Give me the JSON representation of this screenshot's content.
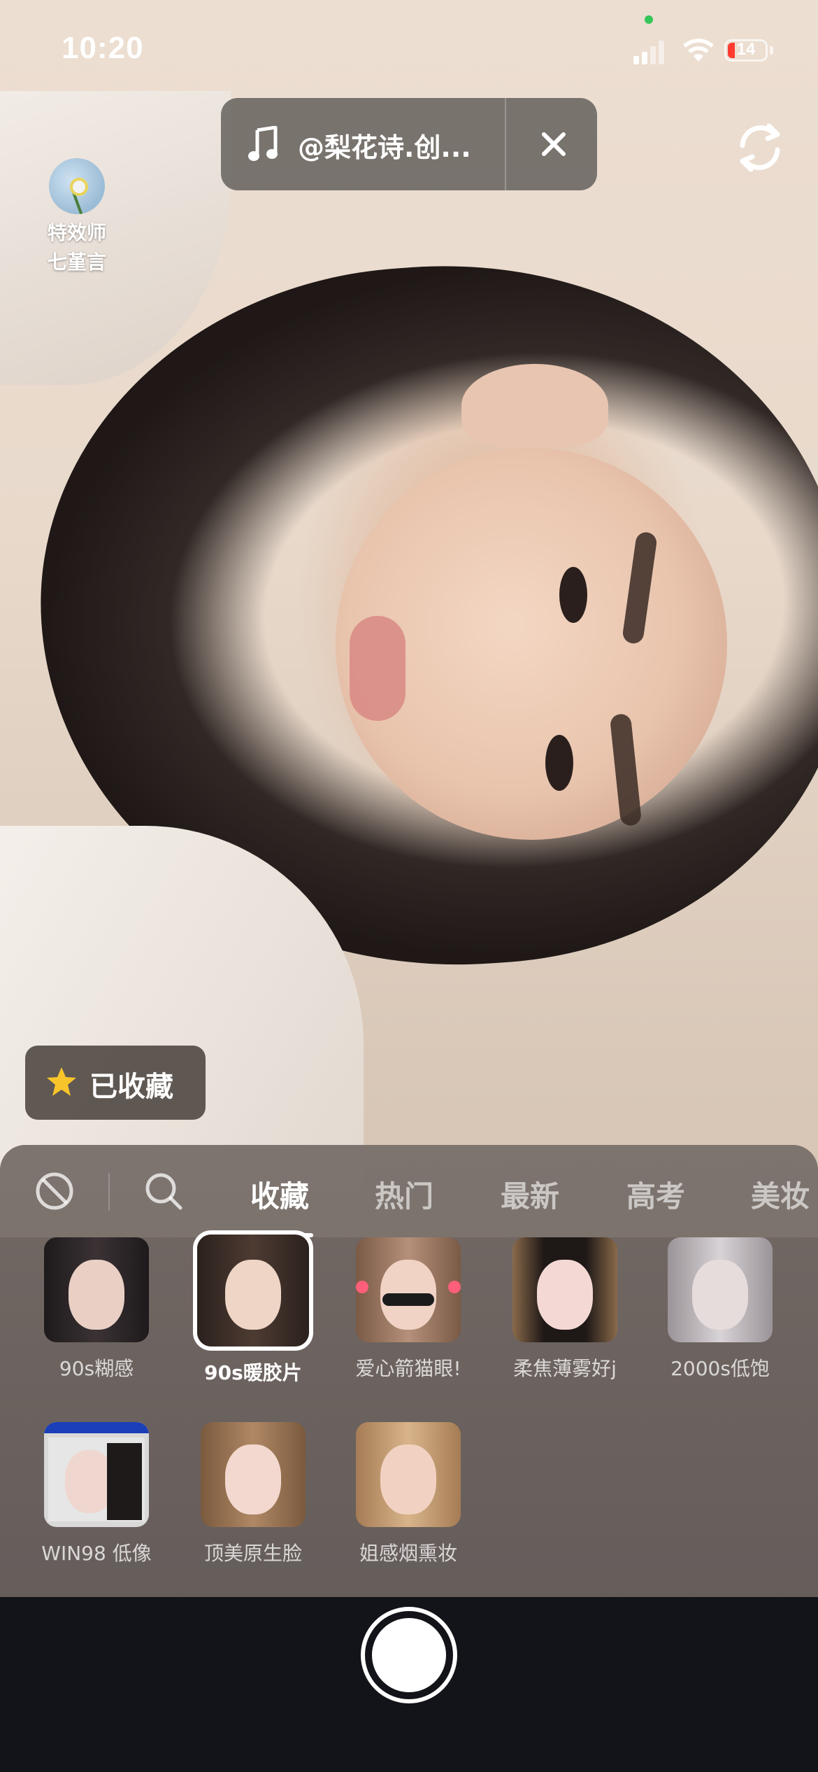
{
  "status_bar": {
    "time": "10:20",
    "battery": "14"
  },
  "music": {
    "label": "@梨花诗.创..."
  },
  "creator": {
    "line1": "特效师",
    "line2": "七堇言"
  },
  "favorite_button": {
    "label": "已收藏"
  },
  "tabs": [
    {
      "label": "收藏",
      "active": true
    },
    {
      "label": "热门",
      "active": false
    },
    {
      "label": "最新",
      "active": false
    },
    {
      "label": "高考",
      "active": false
    },
    {
      "label": "美妆",
      "active": false
    }
  ],
  "effects": [
    {
      "label": "90s糊感",
      "selected": false
    },
    {
      "label": "90s暖胶片",
      "selected": true
    },
    {
      "label": "爱心箭猫眼!",
      "selected": false
    },
    {
      "label": "柔焦薄雾好j",
      "selected": false
    },
    {
      "label": "2000s低饱",
      "selected": false
    },
    {
      "label": "WIN98 低像",
      "selected": false
    },
    {
      "label": "顶美原生脸",
      "selected": false
    },
    {
      "label": "姐感烟熏妆",
      "selected": false
    }
  ],
  "colors": {
    "accent": "#ffffff",
    "battery_low": "#ff3b30",
    "star": "#f7c52b"
  }
}
